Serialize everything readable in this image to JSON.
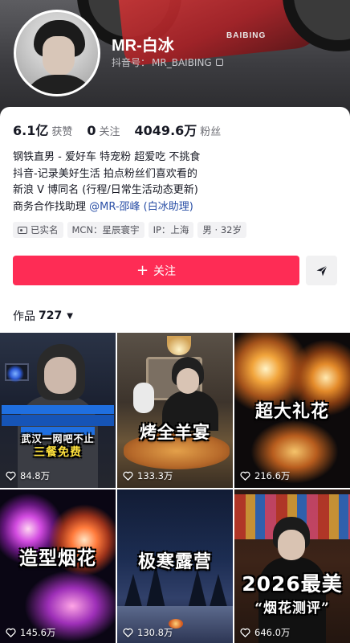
{
  "profile": {
    "nickname": "MR-白冰",
    "douyin_id_label": "抖音号：",
    "douyin_id": "MR_BAIBING",
    "header_decoration_text": "BAIBING"
  },
  "stats": [
    {
      "value": "6.1亿",
      "label": "获赞"
    },
    {
      "value": "0",
      "label": "关注"
    },
    {
      "value": "4049.6万",
      "label": "粉丝"
    }
  ],
  "bio": {
    "line1": "钢铁直男 - 爱好车 特宠粉 超爱吃 不挑食",
    "line2": "抖音-记录美好生活 拍点粉丝们喜欢看的",
    "line3": "新浪 V 博同名 (行程/日常生活动态更新)",
    "line4_prefix": "商务合作找助理 ",
    "line4_mention": "@MR-邵峰 (白冰助理)"
  },
  "tags": {
    "verified": "已实名",
    "mcn": "MCN：星辰寰宇",
    "ip": "IP：上海",
    "gender_age": "男 · 32岁"
  },
  "actions": {
    "follow_label": "关注",
    "follow_plus": "+",
    "follow_color": "#fe2c55"
  },
  "works": {
    "label": "作品",
    "count": "727"
  },
  "videos": [
    {
      "likes": "84.8万",
      "caption_line1": "武汉一网吧不止",
      "caption_line2": "三餐免费"
    },
    {
      "likes": "133.3万",
      "caption": "烤全羊宴"
    },
    {
      "likes": "216.6万",
      "caption": "超大礼花"
    },
    {
      "likes": "145.6万",
      "caption": "造型烟花"
    },
    {
      "likes": "130.8万",
      "caption": "极寒露营"
    },
    {
      "likes": "646.0万",
      "caption_line1": "2026最美",
      "caption_line2": "“烟花测评”"
    }
  ]
}
